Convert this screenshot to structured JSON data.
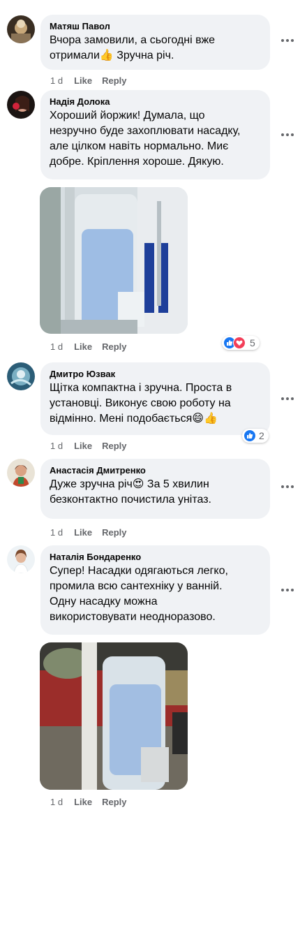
{
  "comments": [
    {
      "author": "Матяш Павол",
      "text": "Вчора замовили, а сьогодні вже\nотримали👍 Зручна річ.",
      "time": "1 d",
      "like_label": "Like",
      "reply_label": "Reply"
    },
    {
      "author": "Надія Долока",
      "text": "Хороший йоржик! Думала, що\nнезручно буде захоплювати насадку,\nале цілком навіть нормально. Миє\nдобре. Кріплення хороше. Дякую.",
      "time": "1 d",
      "like_label": "Like",
      "reply_label": "Reply",
      "reaction_count": "5",
      "reaction_icons": [
        "like-icon",
        "love-icon"
      ]
    },
    {
      "author": "Дмитро Юзвак",
      "text": "Щітка компактна і зручна. Проста в\nустановці. Виконує свою роботу на\nвідмінно. Мені подобається😄👍",
      "time": "1 d",
      "like_label": "Like",
      "reply_label": "Reply",
      "reaction_count": "2",
      "reaction_icons": [
        "like-icon"
      ]
    },
    {
      "author": "Анастасія Дмитренко",
      "text": "Дуже зручна річ😍 За 5 хвилин\nбезконтактно почистила унітаз.",
      "time": "1 d",
      "like_label": "Like",
      "reply_label": "Reply"
    },
    {
      "author": "Наталія Бондаренко",
      "text": "Супер! Насадки одягаються легко,\nпромила всю сантехніку у ванній.\nОдну насадку можна\nвикористовувати неодноразово.",
      "time": "1 d",
      "like_label": "Like",
      "reply_label": "Reply"
    }
  ],
  "colors": {
    "bubble": "#f0f2f5",
    "meta_text": "#65676b",
    "like_blue": "#1877f2",
    "love_red": "#f33e58"
  }
}
